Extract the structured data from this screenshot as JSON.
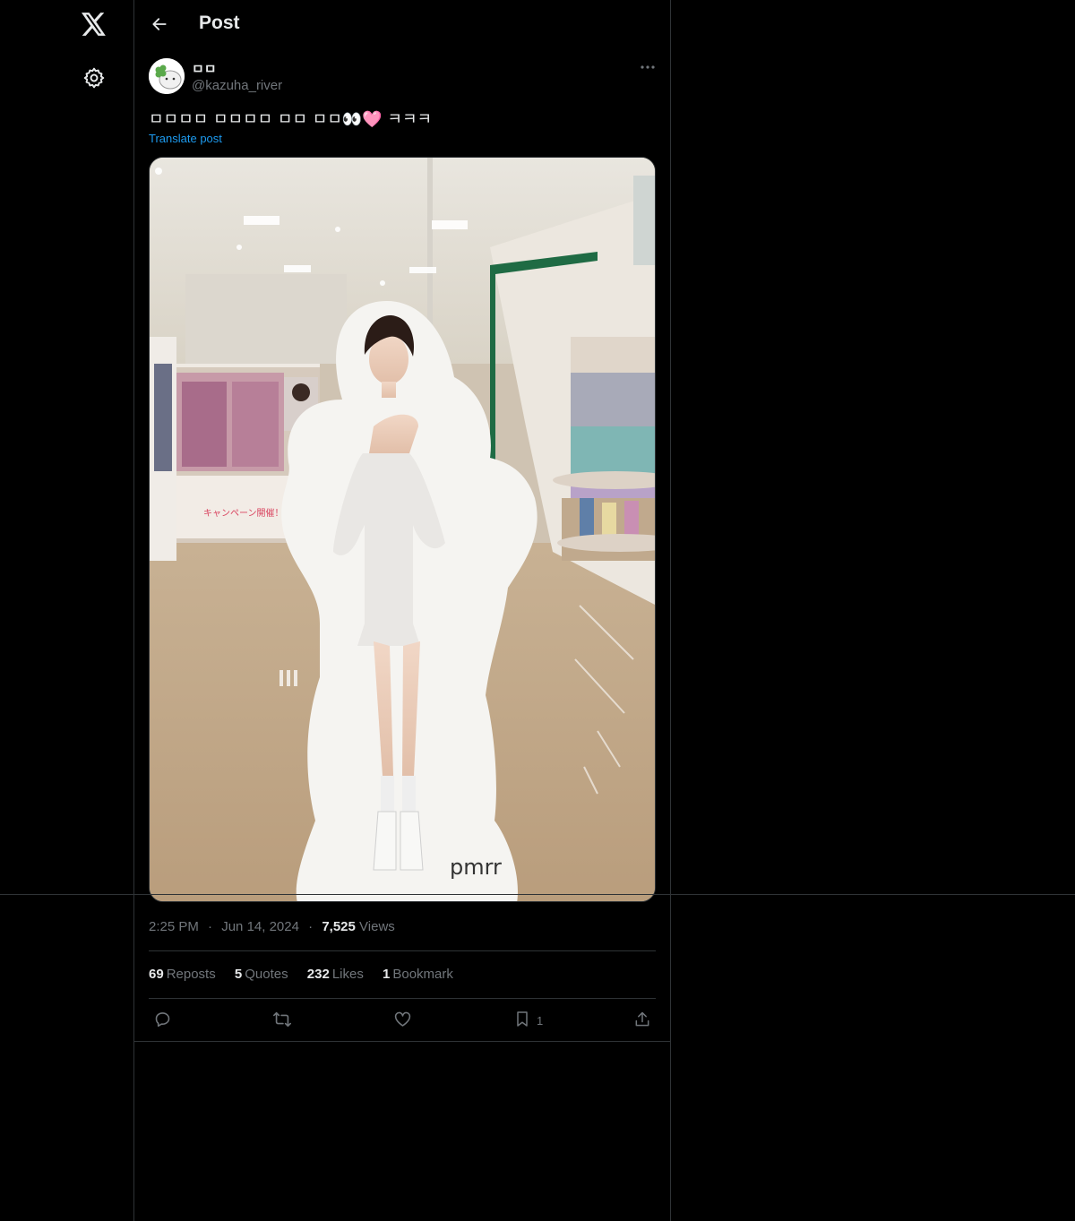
{
  "header": {
    "title": "Post"
  },
  "author": {
    "name": "ㅁㅁ",
    "handle": "@kazuha_river"
  },
  "post": {
    "text": "ㅁㅁㅁㅁ ㅁㅁㅁㅁ ㅁㅁ ㅁㅁ👀🩷 ㅋㅋㅋ",
    "translate_label": "Translate post",
    "image_logo_text": "pmrr"
  },
  "meta": {
    "time": "2:25 PM",
    "date": "Jun 14, 2024",
    "views_count": "7,525",
    "views_label": "Views",
    "dot": "·"
  },
  "stats": {
    "reposts_count": "69",
    "reposts_label": "Reposts",
    "quotes_count": "5",
    "quotes_label": "Quotes",
    "likes_count": "232",
    "likes_label": "Likes",
    "bookmarks_count": "1",
    "bookmarks_label": "Bookmark"
  },
  "actions": {
    "bookmark_count": "1"
  },
  "colors": {
    "background": "#000000",
    "text": "#e7e9ea",
    "muted": "#71767b",
    "link": "#1d9bf0",
    "border": "#2f3336"
  },
  "icons": [
    "x-logo-icon",
    "gear-icon",
    "back-arrow-icon",
    "more-icon",
    "reply-icon",
    "repost-icon",
    "like-icon",
    "bookmark-icon",
    "share-icon"
  ]
}
